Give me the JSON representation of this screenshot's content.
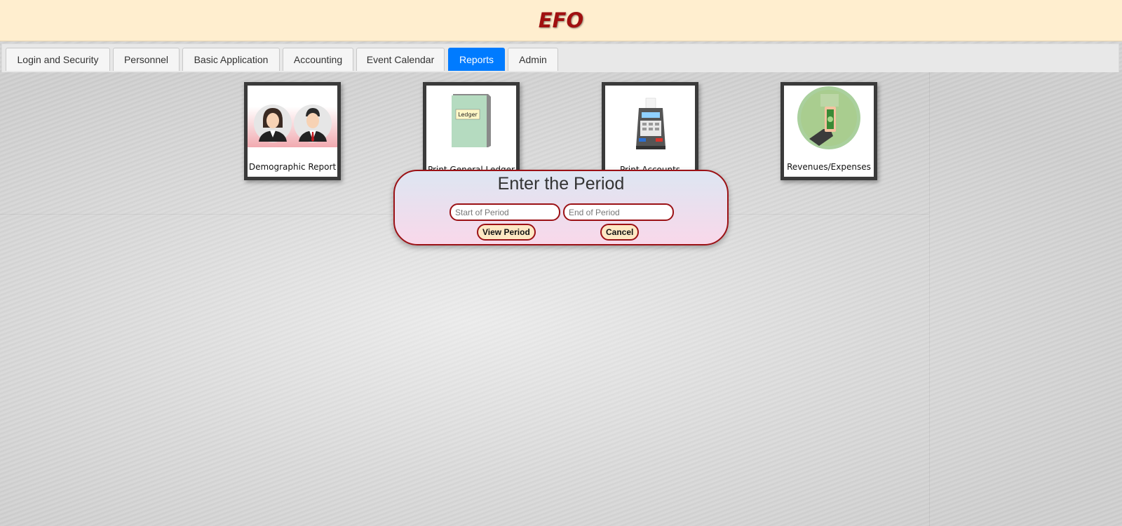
{
  "header": {
    "title": "EFO"
  },
  "tabs": [
    {
      "label": "Login and Security",
      "active": false
    },
    {
      "label": "Personnel",
      "active": false
    },
    {
      "label": "Basic Application",
      "active": false
    },
    {
      "label": "Accounting",
      "active": false
    },
    {
      "label": "Event Calendar",
      "active": false
    },
    {
      "label": "Reports",
      "active": true
    },
    {
      "label": "Admin",
      "active": false
    }
  ],
  "tiles": [
    {
      "label": "Demographic Report",
      "icon": "people-icon"
    },
    {
      "label": "Print General Ledger",
      "icon": "ledger-book-icon",
      "icon_text": "Ledger"
    },
    {
      "label": "Print Accounts",
      "icon": "cash-register-icon"
    },
    {
      "label": "Revenues/Expenses",
      "icon": "hand-money-icon"
    }
  ],
  "modal": {
    "title": "Enter the Period",
    "start_placeholder": "Start of Period",
    "end_placeholder": "End of Period",
    "view_button": "View Period",
    "cancel_button": "Cancel"
  },
  "colors": {
    "header_bg": "#ffeecf",
    "brand": "#a01010",
    "active_tab": "#007bff",
    "modal_border": "#9b1115",
    "button_bg": "#fde8c4"
  }
}
